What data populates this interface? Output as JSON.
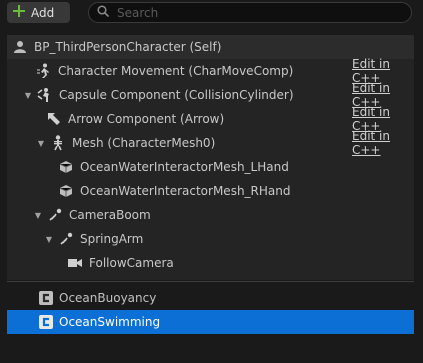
{
  "toolbar": {
    "add_label": "Add",
    "search_placeholder": "Search"
  },
  "root": {
    "label": "BP_ThirdPersonCharacter (Self)"
  },
  "tree": [
    {
      "label": "Character Movement (CharMoveComp)",
      "edit": "Edit in C++"
    },
    {
      "label": "Capsule Component (CollisionCylinder)",
      "edit": "Edit in C++"
    },
    {
      "label": "Arrow Component (Arrow)",
      "edit": "Edit in C++"
    },
    {
      "label": "Mesh (CharacterMesh0)",
      "edit": "Edit in C++"
    },
    {
      "label": "OceanWaterInteractorMesh_LHand"
    },
    {
      "label": "OceanWaterInteractorMesh_RHand"
    },
    {
      "label": "CameraBoom"
    },
    {
      "label": "SpringArm"
    },
    {
      "label": "FollowCamera"
    }
  ],
  "components": [
    {
      "label": "OceanBuoyancy"
    },
    {
      "label": "OceanSwimming"
    }
  ],
  "colors": {
    "selection": "#0b6fd6",
    "add_plus": "#6dbb3a"
  }
}
